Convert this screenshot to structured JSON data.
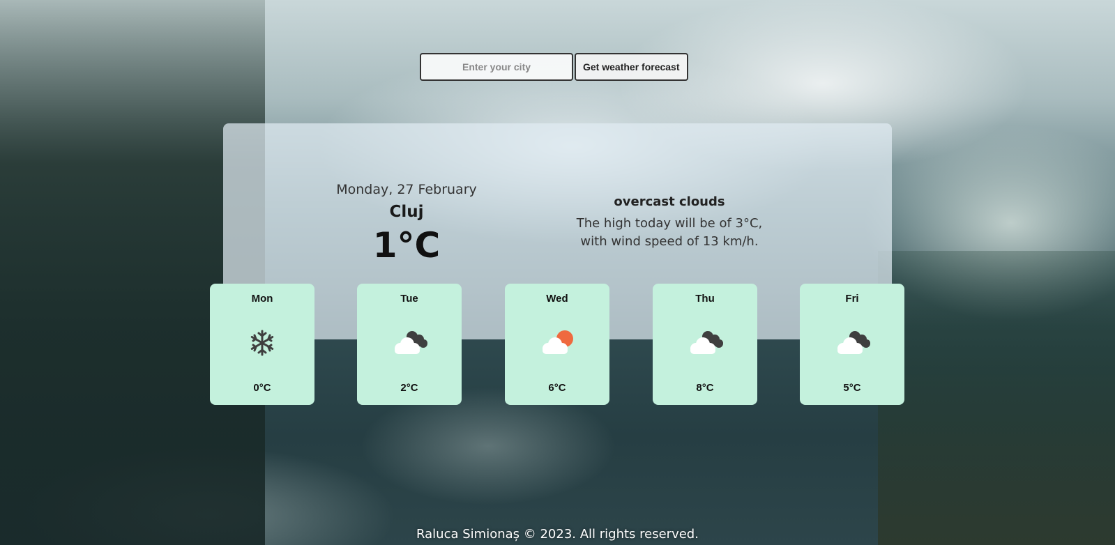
{
  "search": {
    "placeholder": "Enter your city",
    "button_label": "Get weather forecast"
  },
  "current": {
    "date": "Monday, 27 February",
    "city": "Cluj",
    "temperature": "1°C",
    "description": "overcast clouds",
    "summary_line1": "The high today will be of 3°C,",
    "summary_line2": "with wind speed of 13 km/h."
  },
  "forecast": [
    {
      "day": "Mon",
      "icon": "snowflake-icon",
      "temp": "0°C"
    },
    {
      "day": "Tue",
      "icon": "broken-clouds-icon",
      "temp": "2°C"
    },
    {
      "day": "Wed",
      "icon": "partly-cloudy-icon",
      "temp": "6°C"
    },
    {
      "day": "Thu",
      "icon": "broken-clouds-icon",
      "temp": "8°C"
    },
    {
      "day": "Fri",
      "icon": "broken-clouds-icon",
      "temp": "5°C"
    }
  ],
  "footer": {
    "text": "Raluca Simionaș © 2023. All rights reserved."
  },
  "colors": {
    "card_background": "#c4f1dd",
    "sun": "#ef6a3f",
    "dark_cloud": "#3f3f3f",
    "light_cloud": "#ffffff"
  }
}
